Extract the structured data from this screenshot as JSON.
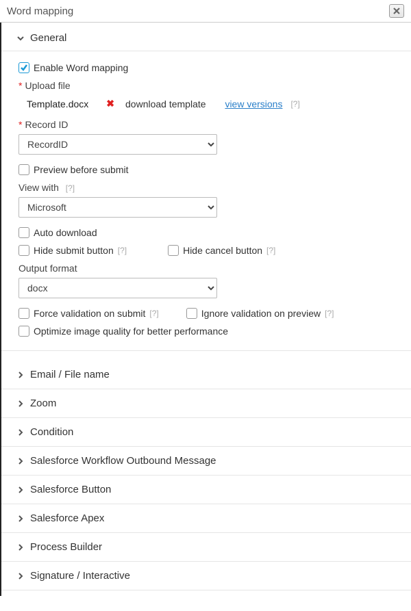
{
  "title": "Word mapping",
  "general": {
    "title": "General",
    "enable_label": "Enable Word mapping",
    "enable_checked": true,
    "upload_label": "Upload file",
    "filename": "Template.docx",
    "download_template_label": "download template",
    "view_versions_label": "view versions",
    "record_id_label": "Record ID",
    "record_id_value": "RecordID",
    "preview_label": "Preview before submit",
    "view_with_label": "View with",
    "view_with_value": "Microsoft",
    "auto_download_label": "Auto download",
    "hide_submit_label": "Hide submit button",
    "hide_cancel_label": "Hide cancel button",
    "output_format_label": "Output format",
    "output_format_value": "docx",
    "force_validation_label": "Force validation on submit",
    "ignore_validation_label": "Ignore validation on preview",
    "optimize_label": "Optimize image quality for better performance"
  },
  "help_marker": "[?]",
  "sections": [
    "Email / File name",
    "Zoom",
    "Condition",
    "Salesforce Workflow Outbound Message",
    "Salesforce Button",
    "Salesforce Apex",
    "Process Builder",
    "Signature / Interactive"
  ]
}
